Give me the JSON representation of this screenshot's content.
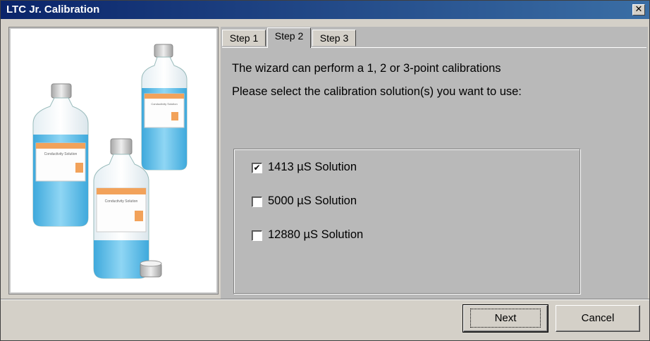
{
  "window": {
    "title": "LTC Jr. Calibration",
    "close_glyph": "✕"
  },
  "tabs": [
    {
      "label": "Step 1",
      "active": false
    },
    {
      "label": "Step 2",
      "active": true
    },
    {
      "label": "Step 3",
      "active": false
    }
  ],
  "panel": {
    "line1": "The wizard can perform a 1, 2 or 3-point calibrations",
    "line2": "Please select the calibration solution(s) you want to use:",
    "options": [
      {
        "label": "1413 µS Solution",
        "checked": true
      },
      {
        "label": "5000 µS Solution",
        "checked": false
      },
      {
        "label": "12880 µS Solution",
        "checked": false
      }
    ]
  },
  "illustration": {
    "bottle_label": "Conductivity Solution"
  },
  "buttons": {
    "next": "Next",
    "cancel": "Cancel"
  },
  "colors": {
    "title_bar": "#0a246a",
    "bottle_liquid": "#5bbfe8",
    "label_stripe": "#f2a25a"
  }
}
